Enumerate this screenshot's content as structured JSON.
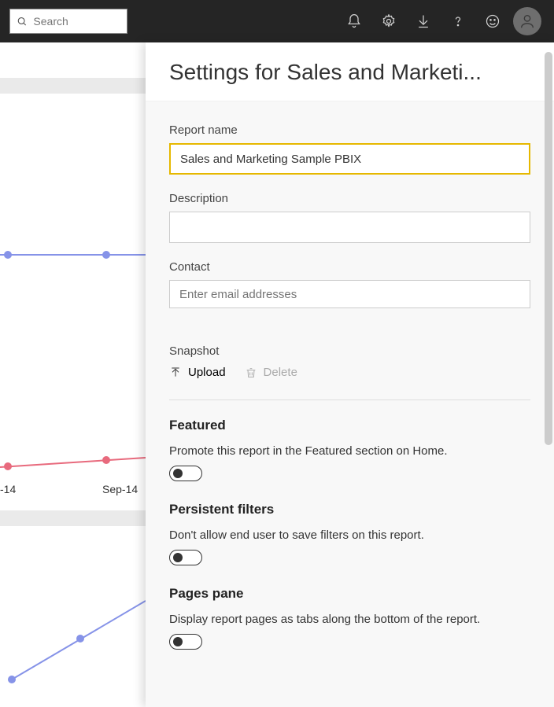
{
  "topbar": {
    "search_placeholder": "Search"
  },
  "background": {
    "axis_labels": [
      "-14",
      "Sep-14"
    ]
  },
  "panel": {
    "title": "Settings for Sales and Marketi...",
    "report_name": {
      "label": "Report name",
      "value": "Sales and Marketing Sample PBIX"
    },
    "description": {
      "label": "Description",
      "value": ""
    },
    "contact": {
      "label": "Contact",
      "placeholder": "Enter email addresses",
      "value": ""
    },
    "snapshot": {
      "label": "Snapshot",
      "upload": "Upload",
      "delete": "Delete"
    },
    "featured": {
      "title": "Featured",
      "desc": "Promote this report in the Featured section on Home.",
      "value": false
    },
    "persistent": {
      "title": "Persistent filters",
      "desc": "Don't allow end user to save filters on this report.",
      "value": false
    },
    "pages_pane": {
      "title": "Pages pane",
      "desc": "Display report pages as tabs along the bottom of the report.",
      "value": false
    }
  },
  "chart_data": [
    {
      "type": "line",
      "series": [
        {
          "name": "blue",
          "color": "#8693e8",
          "values": [
            325,
            325,
            325
          ]
        }
      ],
      "note": "partial line segment visible behind panel"
    },
    {
      "type": "line",
      "categories": [
        "-14",
        "Sep-14"
      ],
      "series": [
        {
          "name": "red",
          "color": "#e86a7d",
          "values": [
            595,
            588,
            585
          ]
        }
      ]
    },
    {
      "type": "line",
      "series": [
        {
          "name": "blue2",
          "color": "#8693e8",
          "values": [
            870,
            780
          ]
        }
      ]
    }
  ]
}
